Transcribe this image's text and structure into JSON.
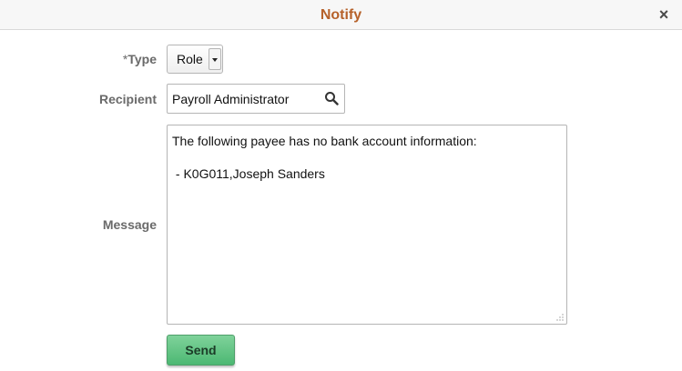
{
  "dialog": {
    "title": "Notify",
    "close_glyph": "×"
  },
  "form": {
    "type": {
      "required_marker": "*",
      "label": "Type",
      "value": "Role"
    },
    "recipient": {
      "label": "Recipient",
      "value": "Payroll Administrator",
      "icon": "search-icon"
    },
    "message": {
      "label": "Message",
      "value": "The following payee has no bank account information:\n\n - K0G011,Joseph Sanders"
    },
    "send_label": "Send"
  },
  "colors": {
    "title": "#b6612a",
    "label": "#6a6a6a",
    "send_button": "#5cc27f"
  }
}
